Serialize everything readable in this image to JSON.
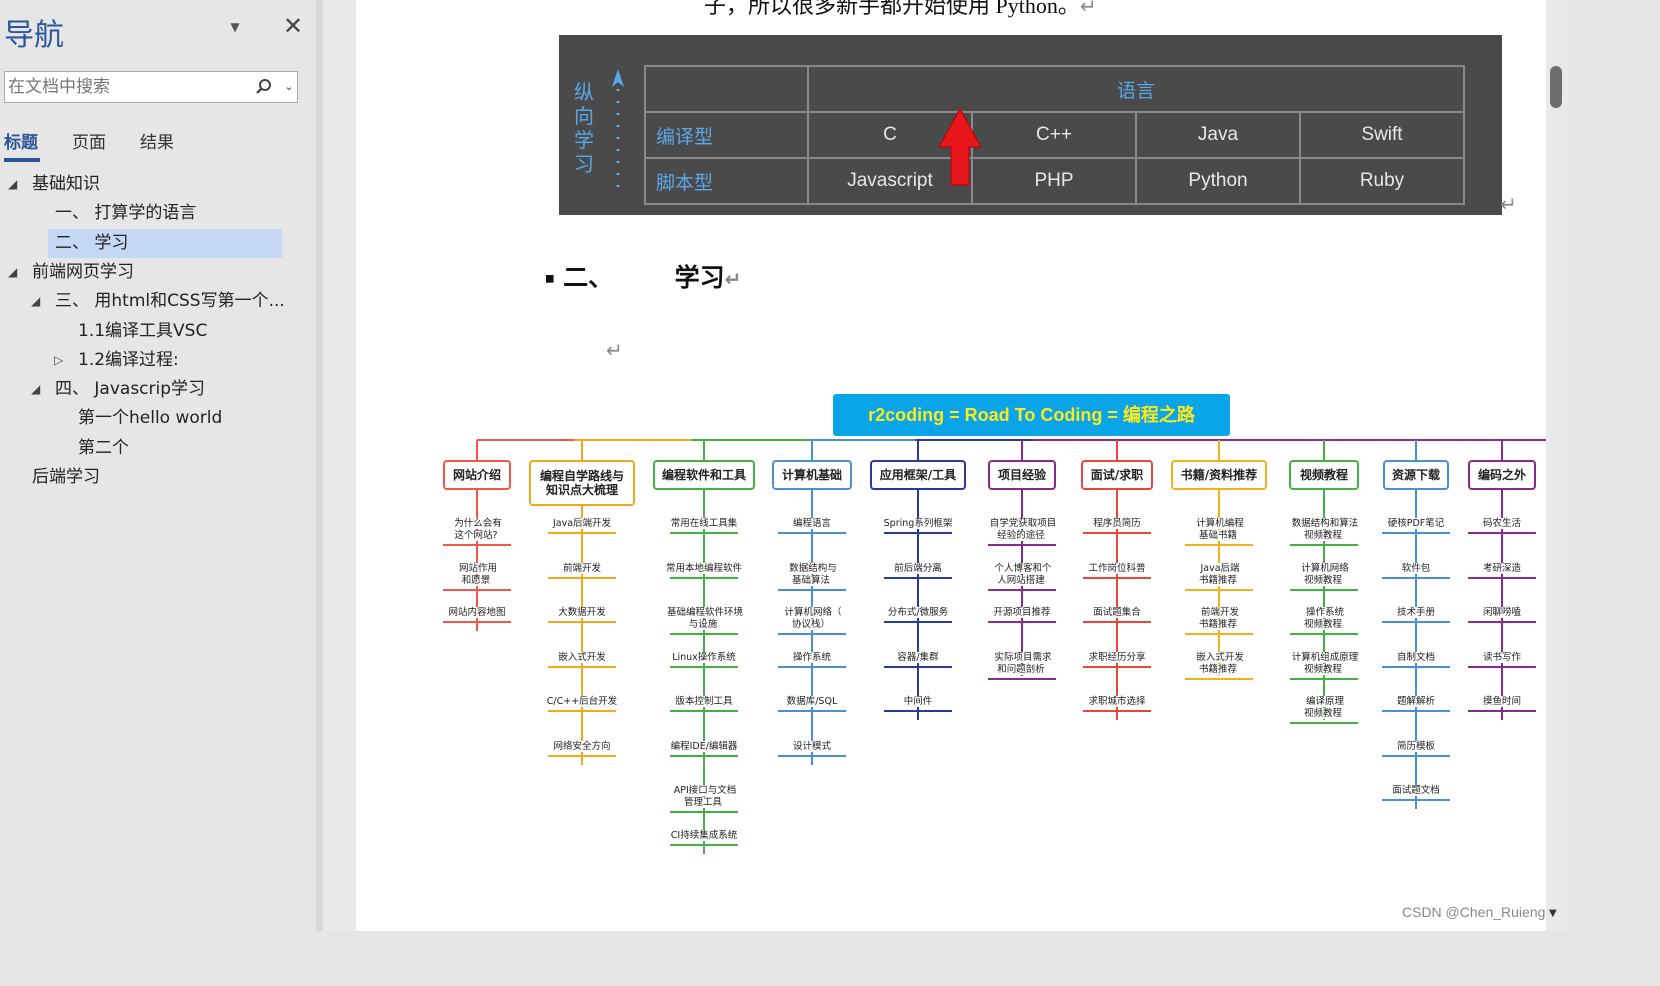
{
  "nav": {
    "title": "导航",
    "search_placeholder": "在文档中搜索",
    "tabs": [
      "标题",
      "页面",
      "结果"
    ],
    "tree": [
      {
        "label": "基础知识",
        "level": 0,
        "expanded": true
      },
      {
        "label": "一、 打算学的语言",
        "level": 1
      },
      {
        "label": "二、 学习",
        "level": 1,
        "selected": true
      },
      {
        "label": "前端网页学习",
        "level": 0,
        "expanded": true
      },
      {
        "label": "三、 用html和CSS写第一个...",
        "level": 1,
        "expanded": true
      },
      {
        "label": "1.1编译工具VSC",
        "level": 2
      },
      {
        "label": "1.2编译过程:",
        "level": 2,
        "collapsed": true
      },
      {
        "label": "四、 Javascrip学习",
        "level": 1,
        "expanded": true
      },
      {
        "label": "第一个hello world",
        "level": 2
      },
      {
        "label": "第二个",
        "level": 2
      },
      {
        "label": "后端学习",
        "level": 0
      }
    ]
  },
  "doc": {
    "top_text": "子，所以很多新手都开始使用 Python。",
    "heading_number": "二、",
    "heading_text": "学习",
    "lang_table": {
      "vertical_label": "纵向学习",
      "header": "语言",
      "rows": [
        {
          "type": "编译型",
          "langs": [
            "C",
            "C++",
            "Java",
            "Swift"
          ]
        },
        {
          "type": "脚本型",
          "langs": [
            "Javascript",
            "PHP",
            "Python",
            "Ruby"
          ]
        }
      ]
    },
    "mindmap": {
      "title": "r2coding = Road To Coding = 编程之路",
      "categories": [
        {
          "name": "网站介绍",
          "color": "#f0564a",
          "items": [
            "为什么会有\n这个网站?",
            "网站作用\n和愿景",
            "网站内容地图"
          ]
        },
        {
          "name": "编程自学路线与\n知识点大梳理",
          "color": "#f2a91a",
          "items": [
            "Java后端开发",
            "前端开发",
            "大数据开发",
            "嵌入式开发",
            "C/C++后台开发",
            "网络安全方向"
          ]
        },
        {
          "name": "编程软件和工具",
          "color": "#43b043",
          "items": [
            "常用在线工具集",
            "常用本地编程软件",
            "基础编程软件环境\n与设施",
            "Linux操作系统",
            "版本控制工具",
            "编程IDE/编辑器",
            "API接口与文档\n管理工具",
            "CI持续集成系统"
          ]
        },
        {
          "name": "计算机基础",
          "color": "#4a8fd6",
          "items": [
            "编程语言",
            "数据结构与\n基础算法",
            "计算机网络（\n协议栈）",
            "操作系统",
            "数据库/SQL",
            "设计模式"
          ]
        },
        {
          "name": "应用框架/工具",
          "color": "#2a3a9a",
          "items": [
            "Spring系列框架",
            "前后端分离",
            "分布式/微服务",
            "容器/集群",
            "中间件"
          ]
        },
        {
          "name": "项目经验",
          "color": "#8a2a8a",
          "items": [
            "自学党获取项目\n经验的途径",
            "个人博客和个\n人网站搭建",
            "开源项目推荐",
            "实际项目需求\n和问题剖析"
          ]
        },
        {
          "name": "面试/求职",
          "color": "#e8453c",
          "items": [
            "程序员简历",
            "工作岗位科普",
            "面试题集合",
            "求职经历分享",
            "求职城市选择"
          ]
        },
        {
          "name": "书籍/资料推荐",
          "color": "#f2b01a",
          "items": [
            "计算机编程\n基础书籍",
            "Java后端\n书籍推荐",
            "前端开发\n书籍推荐",
            "嵌入式开发\n书籍推荐"
          ]
        },
        {
          "name": "视频教程",
          "color": "#43b043",
          "items": [
            "数据结构和算法\n视频教程",
            "计算机网络\n视频教程",
            "操作系统\n视频教程",
            "计算机组成原理\n视频教程",
            "编译原理\n视频教程"
          ]
        },
        {
          "name": "资源下载",
          "color": "#4a8fd6",
          "items": [
            "硬核PDF笔记",
            "软件包",
            "技术手册",
            "自制文档",
            "题解解析",
            "简历模板",
            "面试题文档"
          ]
        },
        {
          "name": "编码之外",
          "color": "#8a2a8a",
          "items": [
            "码农生活",
            "考研深造",
            "闲聊唠嗑",
            "读书写作",
            "摸鱼时间"
          ]
        }
      ]
    },
    "watermark": "CSDN @Chen_Ruieng"
  },
  "colors": {
    "nav_accent": "#2b579a",
    "selected_bg": "#c5d8f5",
    "mm_title_bg": "#0aa5e8",
    "mm_title_text": "#ffe91a"
  }
}
